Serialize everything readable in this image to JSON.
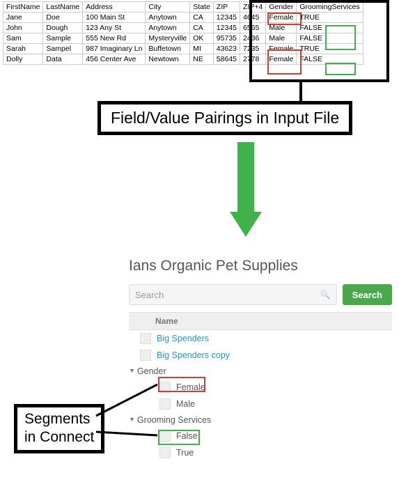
{
  "spreadsheet": {
    "headers": [
      "FirstName",
      "LastName",
      "Address",
      "City",
      "State",
      "ZIP",
      "ZIP+4",
      "Gender",
      "GroomingServices"
    ],
    "rows": [
      [
        "Jane",
        "Doe",
        "100 Main St",
        "Anytown",
        "CA",
        "12345",
        "4645",
        "Female",
        "TRUE"
      ],
      [
        "John",
        "Dough",
        "123 Any St",
        "Anytown",
        "CA",
        "12345",
        "6565",
        "Male",
        "FALSE"
      ],
      [
        "Sam",
        "Sample",
        "555 New Rd",
        "Mysteryville",
        "OK",
        "95735",
        "2436",
        "Male",
        "FALSE"
      ],
      [
        "Sarah",
        "Sampel",
        "987 Imaginary Ln",
        "Buffetown",
        "MI",
        "43623",
        "7235",
        "Female",
        "TRUE"
      ],
      [
        "Dolly",
        "Data",
        "456 Center Ave",
        "Newtown",
        "NE",
        "58645",
        "2778",
        "Female",
        "FALSE"
      ]
    ]
  },
  "callouts": {
    "pairings": "Field/Value Pairings in Input File",
    "segments_line1": "Segments",
    "segments_line2": "in Connect"
  },
  "panel": {
    "title": "Ians Organic Pet Supplies",
    "search_placeholder": "Search",
    "search_button": "Search",
    "name_header": "Name",
    "items": {
      "big_spenders": "Big Spenders",
      "big_spenders_copy": "Big Spenders copy",
      "gender": "Gender",
      "female": "Female",
      "male": "Male",
      "grooming": "Grooming Services",
      "false": "False",
      "true": "True"
    }
  }
}
